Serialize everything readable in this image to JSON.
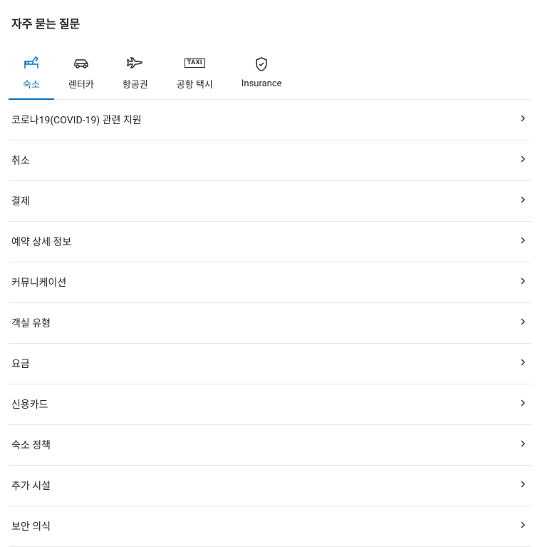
{
  "page": {
    "title": "자주 묻는 질문"
  },
  "tabs": [
    {
      "label": "숙소",
      "icon": "bed",
      "active": true
    },
    {
      "label": "렌터카",
      "icon": "car",
      "active": false
    },
    {
      "label": "항공권",
      "icon": "plane",
      "active": false
    },
    {
      "label": "공항 택시",
      "icon": "taxi",
      "active": false
    },
    {
      "label": "Insurance",
      "icon": "shield",
      "active": false
    }
  ],
  "faq_items": [
    {
      "label": "코로나19(COVID-19) 관련 지원"
    },
    {
      "label": "취소"
    },
    {
      "label": "결제"
    },
    {
      "label": "예약 상세 정보"
    },
    {
      "label": "커뮤니케이션"
    },
    {
      "label": "객실 유형"
    },
    {
      "label": "요금"
    },
    {
      "label": "신용카드"
    },
    {
      "label": "숙소 정책"
    },
    {
      "label": "추가 시설"
    },
    {
      "label": "보안 의식"
    }
  ]
}
